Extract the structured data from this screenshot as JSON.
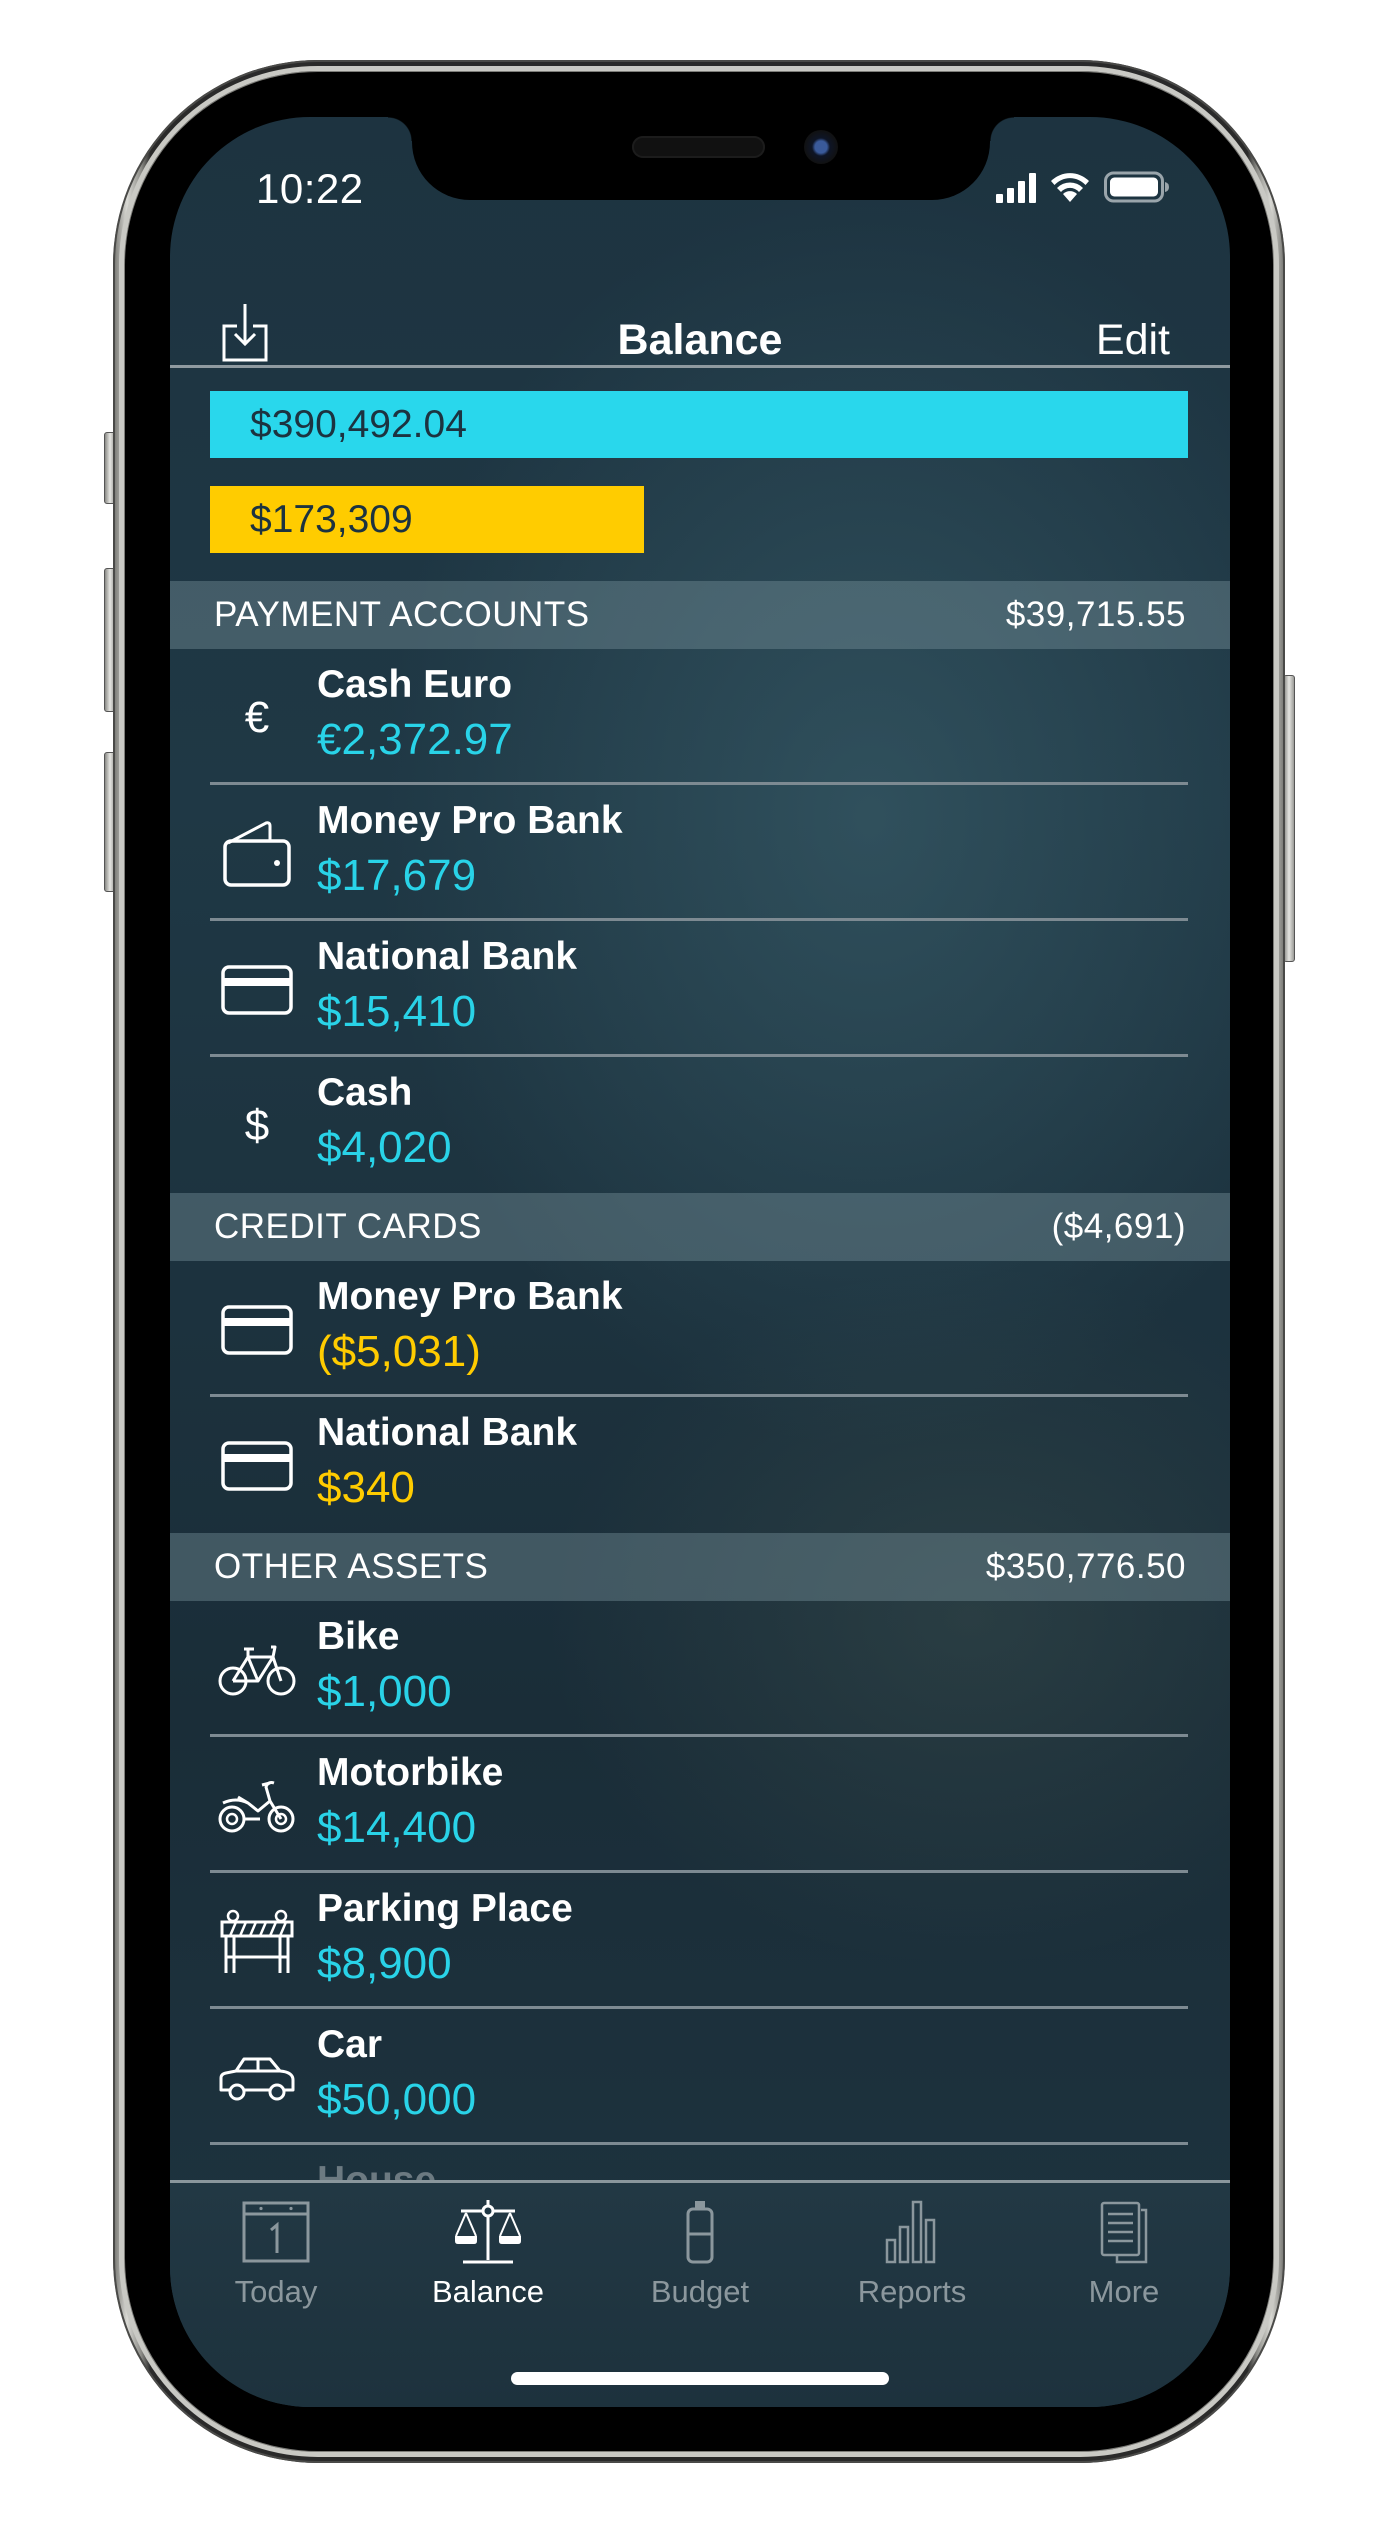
{
  "status_bar": {
    "time": "10:22",
    "icons": [
      "cellular-signal-icon",
      "wifi-icon",
      "battery-icon"
    ]
  },
  "nav": {
    "title": "Balance",
    "edit_label": "Edit",
    "left_icon": "import-icon"
  },
  "totals": {
    "assets": {
      "label": "$390,492.04",
      "value": 390492.04,
      "color": "#29d7ec"
    },
    "debts": {
      "label": "$173,309",
      "value": 173309,
      "color": "#ffcc00"
    }
  },
  "sections": [
    {
      "title": "PAYMENT ACCOUNTS",
      "total": "$39,715.55",
      "accounts": [
        {
          "name": "Cash Euro",
          "value": "€2,372.97",
          "tone": "pos",
          "icon": "euro-icon"
        },
        {
          "name": "Money Pro Bank",
          "value": "$17,679",
          "tone": "pos",
          "icon": "wallet-icon"
        },
        {
          "name": "National Bank",
          "value": "$15,410",
          "tone": "pos",
          "icon": "credit-card-icon"
        },
        {
          "name": "Cash",
          "value": "$4,020",
          "tone": "pos",
          "icon": "dollar-icon"
        }
      ]
    },
    {
      "title": "CREDIT CARDS",
      "total": "($4,691)",
      "accounts": [
        {
          "name": "Money Pro Bank",
          "value": "($5,031)",
          "tone": "neg",
          "icon": "credit-card-icon"
        },
        {
          "name": "National Bank",
          "value": "$340",
          "tone": "neg",
          "icon": "credit-card-icon"
        }
      ]
    },
    {
      "title": "OTHER ASSETS",
      "total": "$350,776.50",
      "accounts": [
        {
          "name": "Bike",
          "value": "$1,000",
          "tone": "pos",
          "icon": "bicycle-icon"
        },
        {
          "name": "Motorbike",
          "value": "$14,400",
          "tone": "pos",
          "icon": "motorbike-icon"
        },
        {
          "name": "Parking Place",
          "value": "$8,900",
          "tone": "pos",
          "icon": "parking-barrier-icon"
        },
        {
          "name": "Car",
          "value": "$50,000",
          "tone": "pos",
          "icon": "car-icon"
        },
        {
          "name": "House",
          "value": "",
          "tone": "pos",
          "icon": "house-icon"
        }
      ]
    }
  ],
  "tabs": [
    {
      "label": "Today",
      "icon": "calendar-icon",
      "active": false
    },
    {
      "label": "Balance",
      "icon": "scales-icon",
      "active": true
    },
    {
      "label": "Budget",
      "icon": "jar-icon",
      "active": false
    },
    {
      "label": "Reports",
      "icon": "bar-chart-icon",
      "active": false
    },
    {
      "label": "More",
      "icon": "documents-icon",
      "active": false
    }
  ]
}
